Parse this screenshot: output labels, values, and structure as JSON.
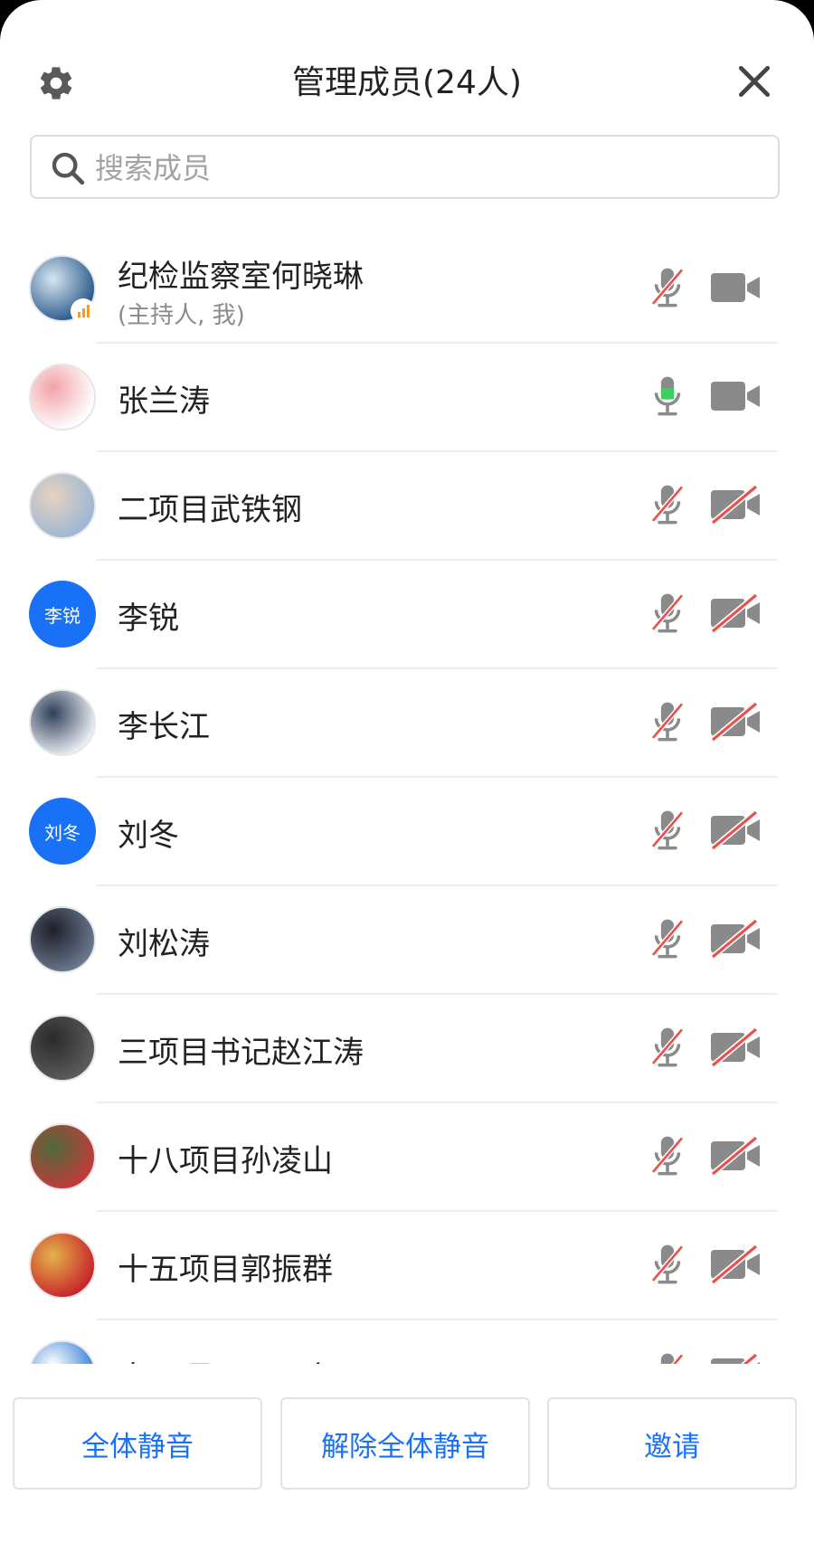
{
  "header": {
    "title": "管理成员(24人)"
  },
  "search": {
    "placeholder": "搜索成员",
    "value": ""
  },
  "members": [
    {
      "name": "纪检监察室何晓琳",
      "role": "(主持人, 我)",
      "avatar": "photo",
      "avatar_colors": [
        "#2b5b8a",
        "#d7e6f2"
      ],
      "mic": "muted",
      "camera": "on",
      "signal_badge": true
    },
    {
      "name": "张兰涛",
      "avatar": "photo",
      "avatar_colors": [
        "#ffffff",
        "#f2a3a8"
      ],
      "mic": "active",
      "camera": "on"
    },
    {
      "name": "二项目武铁钢",
      "avatar": "photo",
      "avatar_colors": [
        "#9cb7d6",
        "#e7d2bf"
      ],
      "mic": "muted",
      "camera": "off"
    },
    {
      "name": "李锐",
      "avatar": "text",
      "avatar_text": "李锐",
      "mic": "muted",
      "camera": "off"
    },
    {
      "name": "李长江",
      "avatar": "photo",
      "avatar_colors": [
        "#eaeef2",
        "#2f3f5a"
      ],
      "mic": "muted",
      "camera": "off"
    },
    {
      "name": "刘冬",
      "avatar": "text",
      "avatar_text": "刘冬",
      "mic": "muted",
      "camera": "off"
    },
    {
      "name": "刘松涛",
      "avatar": "photo",
      "avatar_colors": [
        "#6a7890",
        "#1e2028"
      ],
      "mic": "muted",
      "camera": "off"
    },
    {
      "name": "三项目书记赵江涛",
      "avatar": "photo",
      "avatar_colors": [
        "#5c5c5c",
        "#2a2a2a"
      ],
      "mic": "muted",
      "camera": "off"
    },
    {
      "name": "十八项目孙凌山",
      "avatar": "photo",
      "avatar_colors": [
        "#c23b3b",
        "#4d6b3a"
      ],
      "mic": "muted",
      "camera": "off"
    },
    {
      "name": "十五项目郭振群",
      "avatar": "photo",
      "avatar_colors": [
        "#c8242b",
        "#e3b34a"
      ],
      "mic": "muted",
      "camera": "off"
    },
    {
      "name": "十三项目王三广",
      "avatar": "photo",
      "avatar_colors": [
        "#2f7ed8",
        "#ffffff"
      ],
      "mic": "muted",
      "camera": "off"
    }
  ],
  "footer": {
    "mute_all": "全体静音",
    "unmute_all": "解除全体静音",
    "invite": "邀请"
  },
  "colors": {
    "accent": "#1971f5",
    "icon_gray": "#8a8a8a",
    "mute_slash": "#e9534f",
    "mic_active": "#37d15b"
  }
}
